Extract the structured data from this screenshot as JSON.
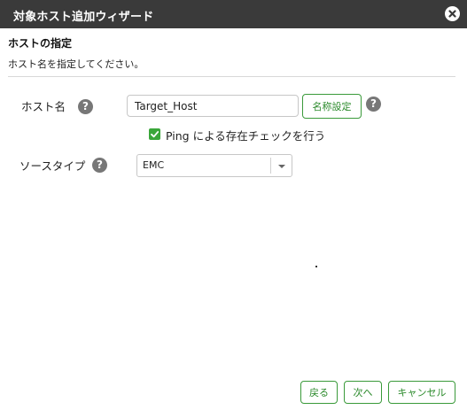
{
  "window": {
    "title": "対象ホスト追加ウィザード"
  },
  "section": {
    "title": "ホストの指定",
    "description": "ホスト名を指定してください。"
  },
  "host": {
    "label": "ホスト名",
    "value": "Target_Host",
    "name_button": "名称設定"
  },
  "ping": {
    "label": "Ping による存在チェックを行う",
    "checked": true
  },
  "source": {
    "label": "ソースタイプ",
    "selected": "EMC"
  },
  "help_glyph": "?",
  "footer": {
    "back": "戻る",
    "next": "次へ",
    "cancel": "キャンセル"
  },
  "colors": {
    "titlebar": "#3a3a3a",
    "accent_green": "#3a9a3a",
    "checkbox": "#3aa63a",
    "help_icon": "#777777"
  },
  "icons": {
    "close": "close-icon",
    "help": "help-icon",
    "check": "check-icon",
    "dropdown": "chevron-down-icon"
  }
}
